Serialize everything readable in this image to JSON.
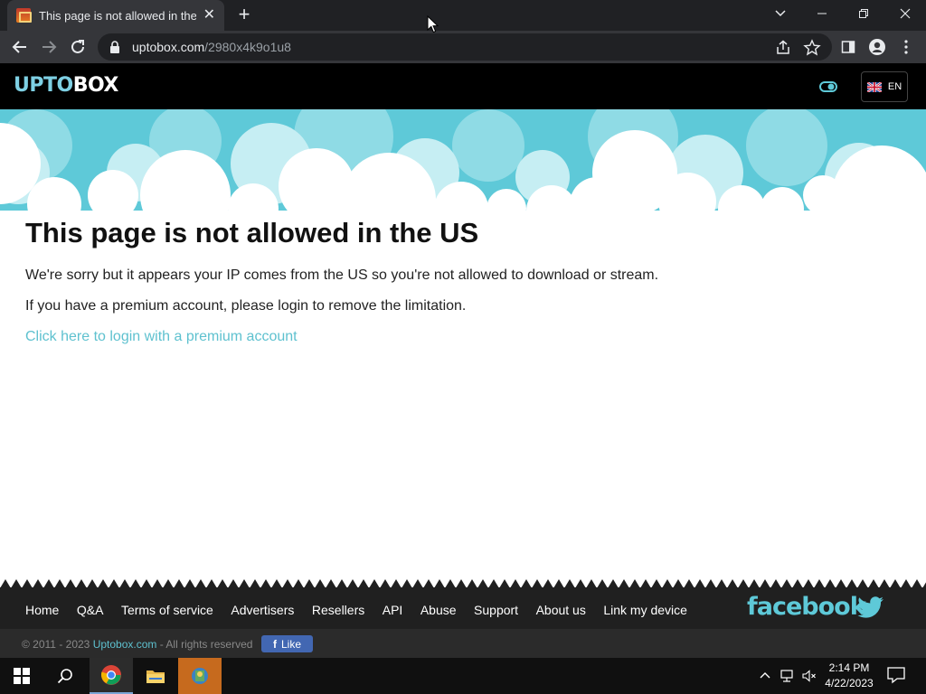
{
  "browser": {
    "tab_title": "This page is not allowed in the U",
    "url_host": "uptobox.com",
    "url_path": "/2980x4k9o1u8"
  },
  "header": {
    "logo_prefix": "UPTO",
    "logo_suffix": "BOX",
    "language": "EN",
    "flag_icon": "uk-flag-icon",
    "toggle_icon": "theme-toggle-icon"
  },
  "content": {
    "title": "This page is not allowed in the US",
    "message": "We're sorry but it appears your IP comes from the US so you're not allowed to download or stream.",
    "premium_note": "If you have a premium account, please login to remove the limitation.",
    "login_link": "Click here to login with a premium account"
  },
  "footer": {
    "links": [
      "Home",
      "Q&A",
      "Terms of service",
      "Advertisers",
      "Resellers",
      "API",
      "Abuse",
      "Support",
      "About us",
      "Link my device"
    ],
    "social_brand": "facebook",
    "copyright_prefix": "© 2011 - 2023",
    "copyright_brand": "Uptobox.com",
    "copyright_suffix": "- All rights reserved",
    "like_label": "Like"
  },
  "taskbar": {
    "time": "2:14 PM",
    "date": "4/22/2023"
  },
  "colors": {
    "accent": "#5ec9d8",
    "link": "#5ec1cf",
    "header_bg": "#000000",
    "footer_bg": "#202020"
  }
}
